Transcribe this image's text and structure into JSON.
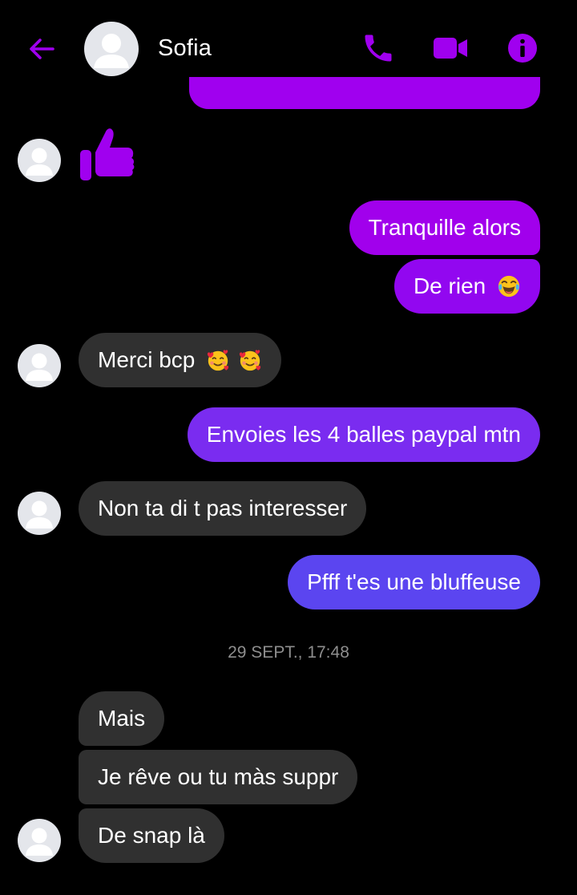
{
  "header": {
    "contact_name": "Sofia",
    "icons": [
      "back-arrow-icon",
      "phone-icon",
      "video-camera-icon",
      "info-icon"
    ],
    "accent_color": "#a000ef"
  },
  "messages": [
    {
      "dir": "in",
      "type": "like",
      "emoji": "thumbs-up-icon"
    },
    {
      "dir": "out",
      "text": "Tranquille alors",
      "color": "#a100ec"
    },
    {
      "dir": "out",
      "text": "De rien",
      "emoji": "tears-of-joy-emoji",
      "color": "#9207f0"
    },
    {
      "dir": "in",
      "text": "Merci bcp",
      "emoji": "smiling-face-with-hearts-emoji x2"
    },
    {
      "dir": "out",
      "text": "Envoies les 4 balles paypal mtn",
      "color": "#7a2cf0"
    },
    {
      "dir": "in",
      "text": "Non ta di t pas interesser"
    },
    {
      "dir": "out",
      "text": "Pfff t'es une bluffeuse",
      "color": "#5b45f0"
    },
    {
      "dir": "in",
      "text": "Mais"
    },
    {
      "dir": "in",
      "text": "Je rêve ou tu màs suppr"
    },
    {
      "dir": "in",
      "text": "De snap là"
    }
  ],
  "timestamp": "29 SEPT., 17:48"
}
